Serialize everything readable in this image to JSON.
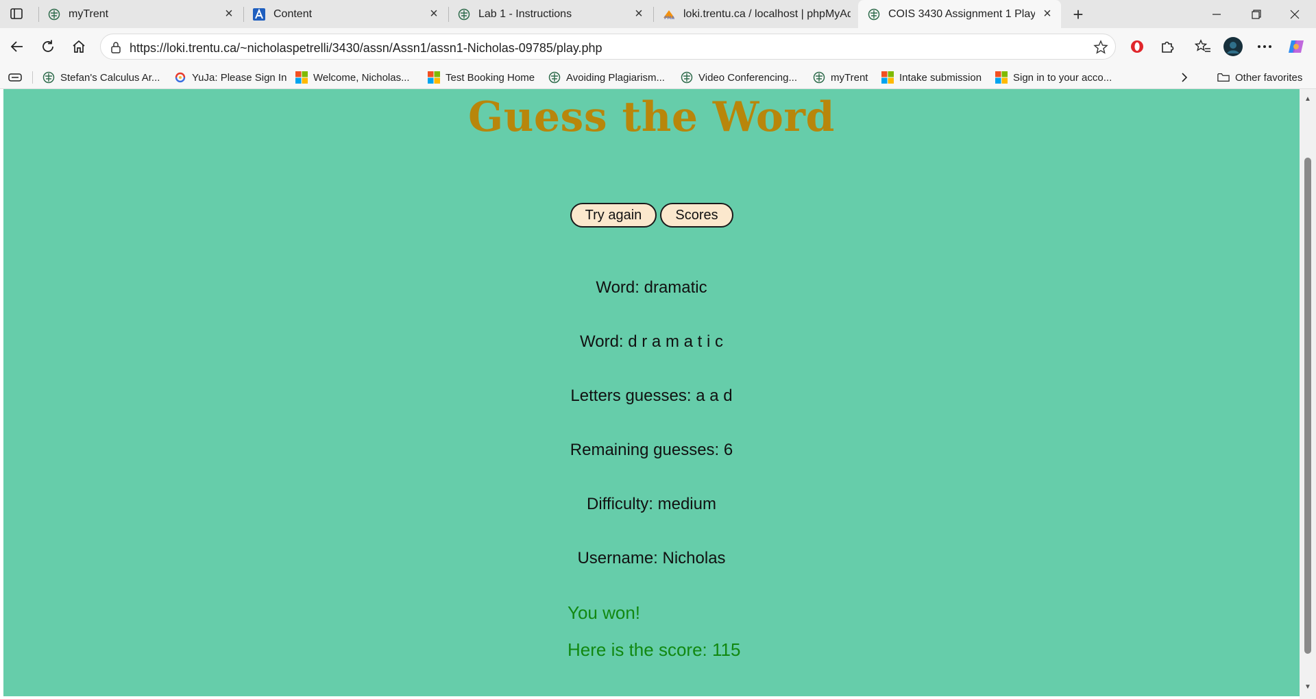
{
  "browser": {
    "tabs": [
      {
        "title": "myTrent",
        "icon": "trent-crest-icon"
      },
      {
        "title": "Content",
        "icon": "brightspace-a-icon"
      },
      {
        "title": "Lab 1 - Instructions",
        "icon": "trent-crest-icon"
      },
      {
        "title": "loki.trentu.ca / localhost | phpMyAdmin",
        "icon": "phpmyadmin-icon"
      },
      {
        "title": "COIS 3430 Assignment 1 Play",
        "icon": "trent-crest-icon",
        "active": true
      }
    ],
    "url": "https://loki.trentu.ca/~nicholaspetrelli/3430/assn/Assn1/assn1-Nicholas-09785/play.php",
    "bookmarks": [
      {
        "label": "Stefan's Calculus Ar...",
        "icon": "trent-crest-icon"
      },
      {
        "label": "YuJa: Please Sign In",
        "icon": "yuja-icon"
      },
      {
        "label": "Welcome, Nicholas...",
        "icon": "microsoft-icon"
      },
      {
        "label": "Test Booking Home",
        "icon": "microsoft-icon"
      },
      {
        "label": "Avoiding Plagiarism...",
        "icon": "trent-crest-icon"
      },
      {
        "label": "Video Conferencing...",
        "icon": "trent-crest-icon"
      },
      {
        "label": "myTrent",
        "icon": "trent-crest-icon"
      },
      {
        "label": "Intake submission",
        "icon": "microsoft-icon"
      },
      {
        "label": "Sign in to your acco...",
        "icon": "microsoft-icon"
      }
    ],
    "other_favorites": "Other favorites"
  },
  "game": {
    "title": "Guess the Word",
    "buttons": {
      "try_again": "Try again",
      "scores": "Scores"
    },
    "word_line": "Word: dramatic",
    "spaced_word_line": "Word: d r a m a t i c",
    "letters_line": "Letters guesses: a a d",
    "remaining_line": "Remaining guesses: 6",
    "difficulty_line": "Difficulty: medium",
    "username_line": "Username: Nicholas",
    "win_message": "You won!",
    "score_message": "Here is the score: 115"
  },
  "colors": {
    "page_background": "#66cdaa",
    "title_color": "#b8860b",
    "button_fill": "#fbe8cd",
    "win_text": "#118811"
  }
}
